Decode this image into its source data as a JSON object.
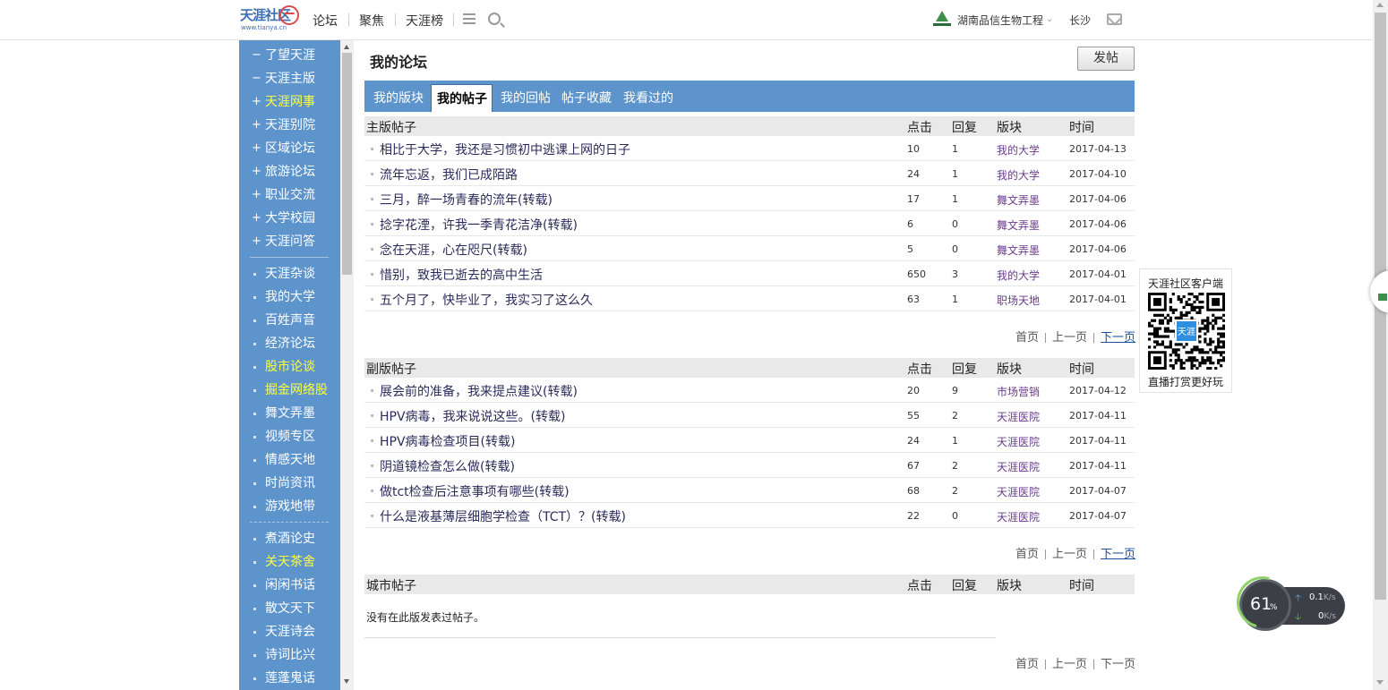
{
  "header": {
    "logo_text": "天涯社区",
    "logo_url_text": "www.tianya.cn",
    "nav": [
      "论坛",
      "聚焦",
      "天涯榜"
    ],
    "org_name": "湖南品信生物工程",
    "city": "长沙",
    "icons": {
      "menu": "menu-icon",
      "search": "search-icon",
      "mail": "mail-icon",
      "org_logo": "org-logo-icon"
    }
  },
  "sidebar": {
    "groups": [
      [
        {
          "mark": "−",
          "label": "了望天涯",
          "highlight": false
        },
        {
          "mark": "−",
          "label": "天涯主版",
          "highlight": false
        },
        {
          "mark": "+",
          "label": "天涯网事",
          "highlight": true
        },
        {
          "mark": "+",
          "label": "天涯别院",
          "highlight": false
        },
        {
          "mark": "+",
          "label": "区域论坛",
          "highlight": false
        },
        {
          "mark": "+",
          "label": "旅游论坛",
          "highlight": false
        },
        {
          "mark": "+",
          "label": "职业交流",
          "highlight": false
        },
        {
          "mark": "+",
          "label": "大学校园",
          "highlight": false
        },
        {
          "mark": "+",
          "label": "天涯问答",
          "highlight": false
        }
      ],
      [
        {
          "mark": "",
          "label": "天涯杂谈",
          "highlight": false
        },
        {
          "mark": "",
          "label": "我的大学",
          "highlight": false
        },
        {
          "mark": "",
          "label": "百姓声音",
          "highlight": false
        },
        {
          "mark": "",
          "label": "经济论坛",
          "highlight": false
        },
        {
          "mark": "",
          "label": "股市论谈",
          "highlight": true
        },
        {
          "mark": "",
          "label": "掘金网络股",
          "highlight": true
        },
        {
          "mark": "",
          "label": "舞文弄墨",
          "highlight": false
        },
        {
          "mark": "",
          "label": "视频专区",
          "highlight": false
        },
        {
          "mark": "",
          "label": "情感天地",
          "highlight": false
        },
        {
          "mark": "",
          "label": "时尚资讯",
          "highlight": false
        },
        {
          "mark": "",
          "label": "游戏地带",
          "highlight": false
        }
      ],
      [
        {
          "mark": "",
          "label": "煮酒论史",
          "highlight": false
        },
        {
          "mark": "",
          "label": "关天茶舍",
          "highlight": true
        },
        {
          "mark": "",
          "label": "闲闲书话",
          "highlight": false
        },
        {
          "mark": "",
          "label": "散文天下",
          "highlight": false
        },
        {
          "mark": "",
          "label": "天涯诗会",
          "highlight": false
        },
        {
          "mark": "",
          "label": "诗词比兴",
          "highlight": false
        },
        {
          "mark": "",
          "label": "莲蓬鬼话",
          "highlight": false
        }
      ]
    ]
  },
  "main": {
    "title": "我的论坛",
    "post_button": "发帖",
    "tabs": [
      "我的版块",
      "我的帖子",
      "我的回帖",
      "帖子收藏",
      "我看过的"
    ],
    "active_tab": 1,
    "columns": {
      "clicks": "点击",
      "replies": "回复",
      "board": "版块",
      "time": "时间"
    },
    "sections": [
      {
        "name": "主版帖子",
        "rows": [
          {
            "title": "相比于大学，我还是习惯初中逃课上网的日子",
            "clicks": "10",
            "replies": "1",
            "board": "我的大学",
            "time": "2017-04-13"
          },
          {
            "title": "流年忘返，我们已成陌路",
            "clicks": "24",
            "replies": "1",
            "board": "我的大学",
            "time": "2017-04-10"
          },
          {
            "title": "三月，醉一场青春的流年(转载)",
            "clicks": "17",
            "replies": "1",
            "board": "舞文弄墨",
            "time": "2017-04-06"
          },
          {
            "title": "捻字花湮，许我一季青花洁净(转载)",
            "clicks": "6",
            "replies": "0",
            "board": "舞文弄墨",
            "time": "2017-04-06"
          },
          {
            "title": "念在天涯，心在咫尺(转载)",
            "clicks": "5",
            "replies": "0",
            "board": "舞文弄墨",
            "time": "2017-04-06"
          },
          {
            "title": "惜别，致我已逝去的高中生活",
            "clicks": "650",
            "replies": "3",
            "board": "我的大学",
            "time": "2017-04-01"
          },
          {
            "title": "五个月了，快毕业了，我实习了这么久",
            "clicks": "63",
            "replies": "1",
            "board": "职场天地",
            "time": "2017-04-01"
          }
        ]
      },
      {
        "name": "副版帖子",
        "rows": [
          {
            "title": "展会前的准备，我来提点建议(转载)",
            "clicks": "20",
            "replies": "9",
            "board": "市场营销",
            "time": "2017-04-12"
          },
          {
            "title": "HPV病毒，我来说说这些。(转载)",
            "clicks": "55",
            "replies": "2",
            "board": "天涯医院",
            "time": "2017-04-11"
          },
          {
            "title": "HPV病毒检查项目(转载)",
            "clicks": "24",
            "replies": "1",
            "board": "天涯医院",
            "time": "2017-04-11"
          },
          {
            "title": "阴道镜检查怎么做(转载)",
            "clicks": "67",
            "replies": "2",
            "board": "天涯医院",
            "time": "2017-04-11"
          },
          {
            "title": "做tct检查后注意事项有哪些(转载)",
            "clicks": "68",
            "replies": "2",
            "board": "天涯医院",
            "time": "2017-04-07"
          },
          {
            "title": "什么是液基薄层细胞学检查（TCT）？(转载)",
            "clicks": "22",
            "replies": "0",
            "board": "天涯医院",
            "time": "2017-04-07"
          }
        ]
      },
      {
        "name": "城市帖子",
        "rows": [],
        "empty_message": "没有在此版发表过帖子。"
      }
    ],
    "pager": {
      "first": "首页",
      "prev": "上一页",
      "next": "下一页"
    }
  },
  "qr_panel": {
    "title": "天涯社区客户端",
    "subtitle": "直播打赏更好玩",
    "center_label": "天涯"
  },
  "speed_widget": {
    "percent": "61",
    "percent_symbol": "%",
    "up_value": "0.1",
    "up_unit": "K/s",
    "down_value": "0",
    "down_unit": "K/s"
  },
  "colors": {
    "sidebar_bg": "#5d94cc",
    "tab_bar_bg": "#5d94cc",
    "highlight_text": "#ffff3f",
    "board_link": "#6a3a8c",
    "post_title": "#2b2b5b"
  }
}
